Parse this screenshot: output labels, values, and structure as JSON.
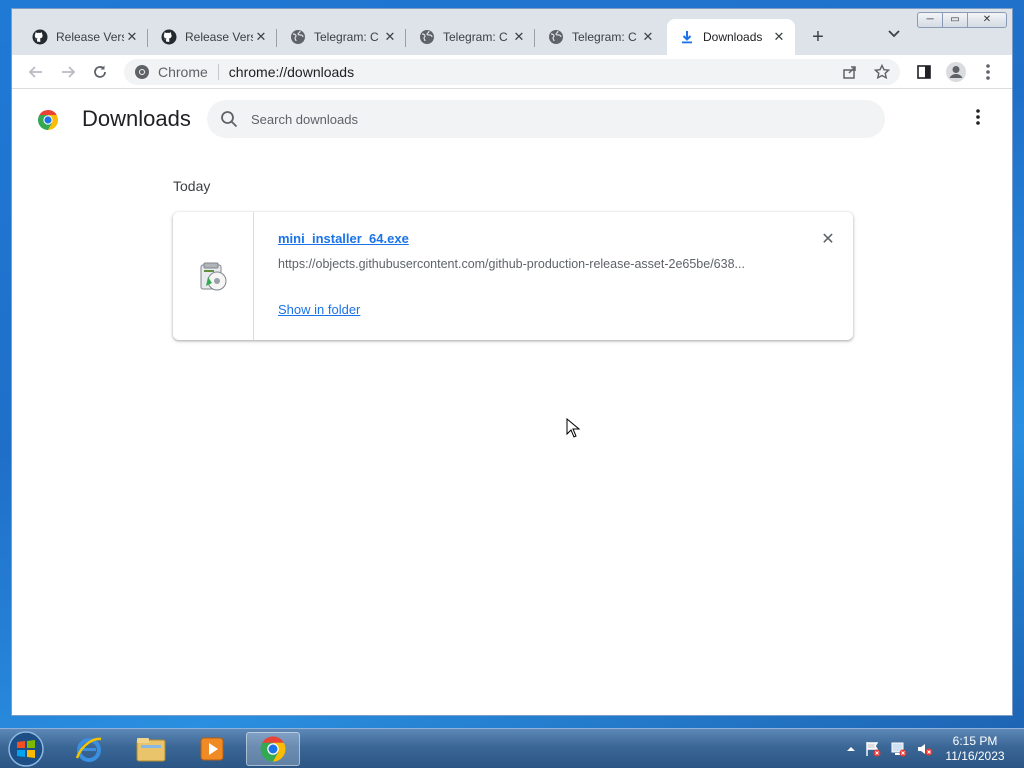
{
  "tabs": [
    {
      "title": "Release Vers",
      "icon": "github-icon"
    },
    {
      "title": "Release Vers",
      "icon": "github-icon"
    },
    {
      "title": "Telegram: C",
      "icon": "globe-icon"
    },
    {
      "title": "Telegram: C",
      "icon": "globe-icon"
    },
    {
      "title": "Telegram: C",
      "icon": "globe-icon"
    },
    {
      "title": "Downloads",
      "icon": "download-icon",
      "active": true
    }
  ],
  "toolbar": {
    "omnibox_label": "Chrome",
    "url": "chrome://downloads"
  },
  "downloads": {
    "title": "Downloads",
    "search_placeholder": "Search downloads",
    "section_label": "Today",
    "item": {
      "file_name": "mini_installer_64.exe",
      "url": "https://objects.githubusercontent.com/github-production-release-asset-2e65be/638...",
      "show_in_folder": "Show in folder"
    }
  },
  "taskbar": {
    "time": "6:15 PM",
    "date": "11/16/2023"
  },
  "colors": {
    "link": "#1a73e8",
    "tabstrip": "#dee3ea",
    "taskbar": "#3b6797"
  }
}
